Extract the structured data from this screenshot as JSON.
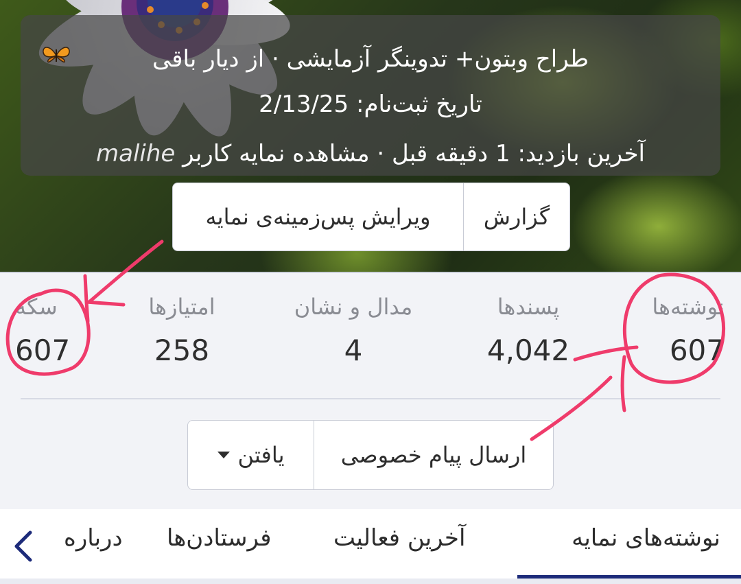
{
  "profile": {
    "title_line": "طراح وبتون+ تدوینگر آزمایشی · از دیار باقی",
    "title_emoji": "butterfly-icon",
    "join_label": "تاریخ ثبت‌نام:",
    "join_date": "2/13/25",
    "visit_label": "آخرین بازدید:",
    "visit_time": "1 دقیقه قبل",
    "viewer_text": "مشاهده نمایه کاربر",
    "username": "malihe",
    "separator": "·"
  },
  "buttons": {
    "report": "گزارش",
    "edit_background": "ویرایش پس‌زمینه‌ی نمایه"
  },
  "stats": [
    {
      "label": "نوشته‌ها",
      "value": "607"
    },
    {
      "label": "پسندها",
      "value": "4,042"
    },
    {
      "label": "مدال و نشان",
      "value": "4"
    },
    {
      "label": "امتیازها",
      "value": "258"
    },
    {
      "label": "سکه",
      "value": "607"
    }
  ],
  "actions": {
    "private_message": "ارسال پیام خصوصی",
    "find": "یافتن"
  },
  "tabs": {
    "posts": "نوشته‌های نمایه",
    "activity": "آخرین فعالیت",
    "senders": "فرستادن‌ها",
    "about": "درباره",
    "active": "posts"
  },
  "colors": {
    "annotation": "#ef3b6b",
    "tab_underline": "#1d2b7a"
  }
}
